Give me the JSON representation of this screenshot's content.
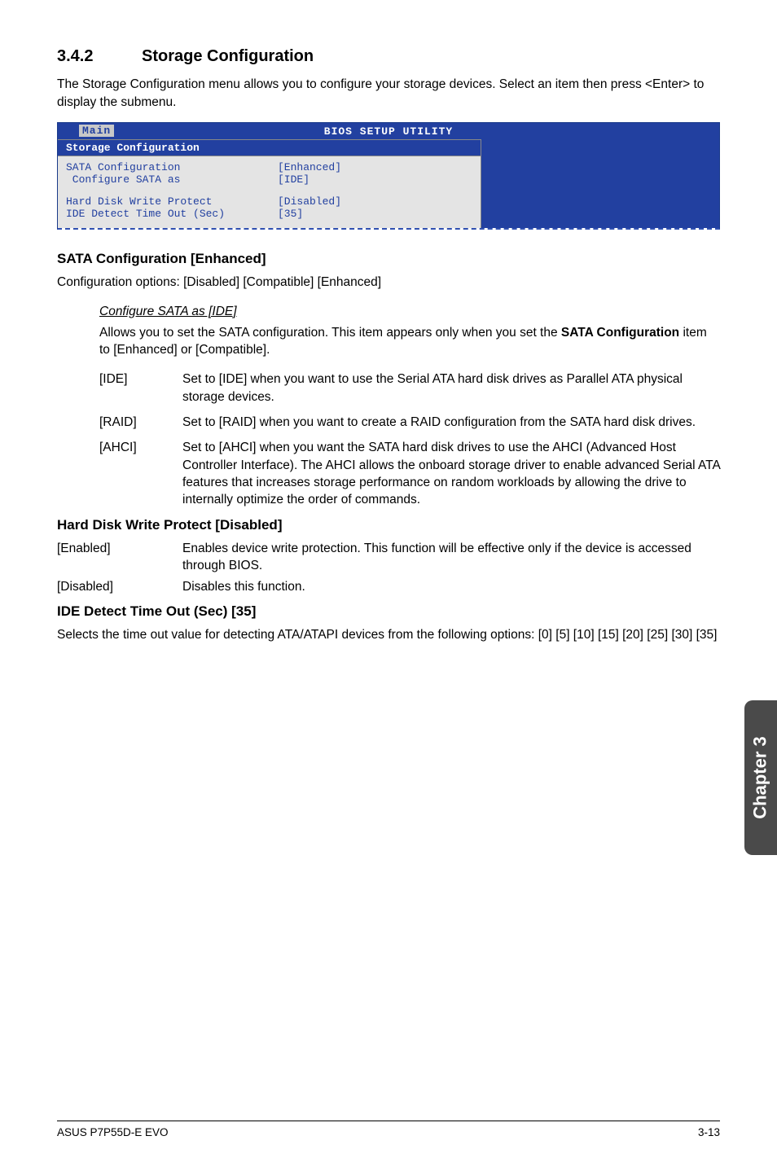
{
  "section": {
    "num": "3.4.2",
    "title": "Storage Configuration"
  },
  "intro": "The Storage Configuration menu allows you to configure your storage devices. Select an item then press <Enter> to display the submenu.",
  "bios": {
    "header": "BIOS SETUP UTILITY",
    "tab": "Main",
    "panel_title": "Storage Configuration",
    "rows": [
      {
        "label": "SATA Configuration",
        "value": "[Enhanced]"
      },
      {
        "label": " Configure SATA as",
        "value": "[IDE]"
      },
      {
        "gap": true
      },
      {
        "label": "Hard Disk Write Protect",
        "value": "[Disabled]"
      },
      {
        "label": "IDE Detect Time Out (Sec)",
        "value": "[35]"
      }
    ]
  },
  "sata_cfg": {
    "heading": "SATA Configuration [Enhanced]",
    "desc": "Configuration options: [Disabled] [Compatible] [Enhanced]",
    "sub_heading": "Configure SATA as [IDE]",
    "sub_desc1": "Allows you to set the SATA configuration. This item appears only when you set the ",
    "sub_desc_bold": "SATA Configuration",
    "sub_desc2": " item to [Enhanced] or [Compatible].",
    "options": [
      {
        "key": "[IDE]",
        "val": "Set to [IDE] when you want to use the Serial ATA hard disk drives as Parallel ATA physical storage devices."
      },
      {
        "key": "[RAID]",
        "val": "Set to [RAID] when you want to create a RAID configuration from the SATA hard disk drives."
      },
      {
        "key": "[AHCI]",
        "val": "Set to [AHCI] when you want the SATA hard disk drives to use the AHCI (Advanced Host Controller Interface). The AHCI allows the onboard storage driver to enable advanced Serial ATA features that increases storage performance on random workloads by allowing the drive to internally optimize the order of commands."
      }
    ]
  },
  "hdwp": {
    "heading": "Hard Disk Write Protect [Disabled]",
    "rows": [
      {
        "key": "[Enabled]",
        "val": "Enables device write protection. This function will be effective only if the device is accessed through BIOS."
      },
      {
        "key": "[Disabled]",
        "val": "Disables this function."
      }
    ]
  },
  "ide_to": {
    "heading": "IDE Detect Time Out (Sec) [35]",
    "desc": "Selects the time out value for detecting ATA/ATAPI devices from the following options: [0] [5] [10] [15] [20] [25] [30] [35]"
  },
  "side_tab": "Chapter 3",
  "footer": {
    "left": "ASUS P7P55D-E EVO",
    "right": "3-13"
  }
}
